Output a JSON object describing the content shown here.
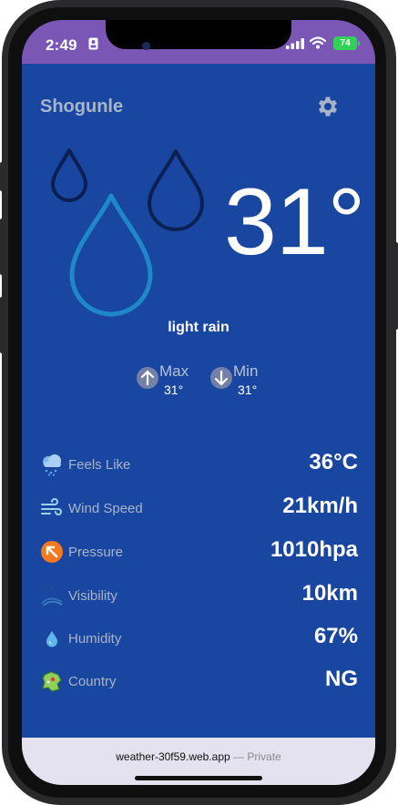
{
  "status": {
    "time": "2:49",
    "battery": "74"
  },
  "header": {
    "city": "Shogunle"
  },
  "current": {
    "temperature": "31°",
    "condition": "light rain"
  },
  "minmax": {
    "max_label": "Max",
    "max_value": "31°",
    "min_label": "Min",
    "min_value": "31°"
  },
  "details": [
    {
      "label": "Feels Like",
      "value": "36°C",
      "icon": "cloud-rain-icon"
    },
    {
      "label": "Wind Speed",
      "value": "21km/h",
      "icon": "wind-icon"
    },
    {
      "label": "Pressure",
      "value": "1010hpa",
      "icon": "pressure-arrow-icon"
    },
    {
      "label": "Visibility",
      "value": "10km",
      "icon": "visibility-icon"
    },
    {
      "label": "Humidity",
      "value": "67%",
      "icon": "droplet-icon"
    },
    {
      "label": "Country",
      "value": "NG",
      "icon": "map-icon"
    }
  ],
  "browser": {
    "url": "weather-30f59.web.app",
    "separator": "—",
    "mode": "Private"
  },
  "colors": {
    "background": "#1846a0",
    "status_bar": "#7a56b5",
    "accent_drop": "#1e88c8",
    "dark_drop": "#0b1f52"
  }
}
